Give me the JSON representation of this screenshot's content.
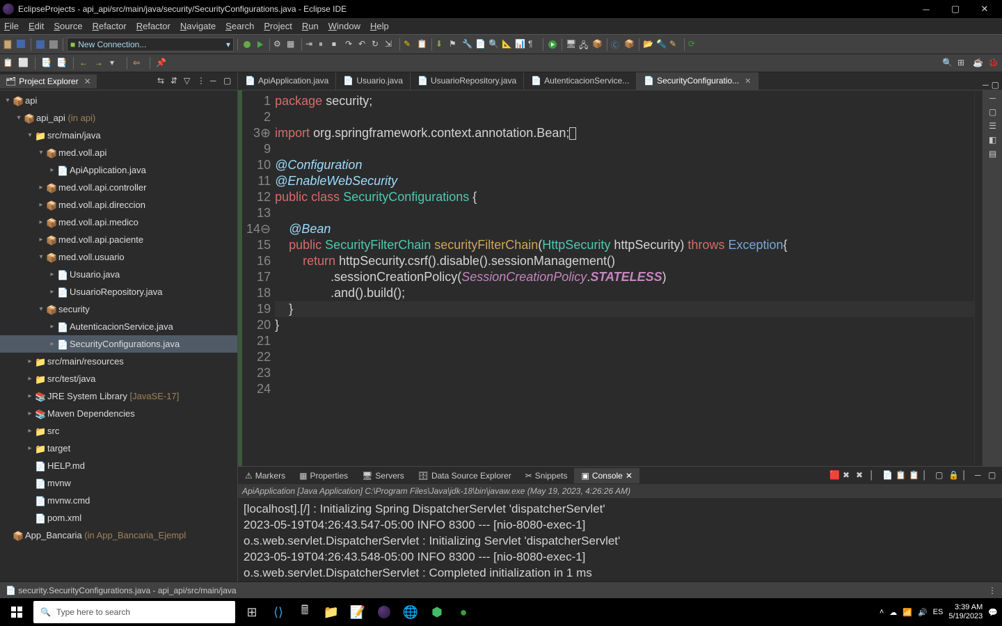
{
  "title_bar": {
    "text": "EclipseProjects - api_api/src/main/java/security/SecurityConfigurations.java - Eclipse IDE"
  },
  "menu": {
    "items": [
      "File",
      "Edit",
      "Source",
      "Refactor",
      "Refactor",
      "Navigate",
      "Search",
      "Project",
      "Run",
      "Window",
      "Help"
    ]
  },
  "toolbar": {
    "combo": "New Connection..."
  },
  "project_explorer": {
    "title": "Project Explorer",
    "tree": [
      {
        "indent": 0,
        "tw": "▾",
        "icon": "proj",
        "label": "api"
      },
      {
        "indent": 1,
        "tw": "▾",
        "icon": "proj",
        "label": "api_api",
        "suffix": " (in api)"
      },
      {
        "indent": 2,
        "tw": "▾",
        "icon": "src",
        "label": "src/main/java"
      },
      {
        "indent": 3,
        "tw": "▾",
        "icon": "pkg",
        "label": "med.voll.api"
      },
      {
        "indent": 4,
        "tw": "▸",
        "icon": "java",
        "label": "ApiApplication.java"
      },
      {
        "indent": 3,
        "tw": "▸",
        "icon": "pkg",
        "label": "med.voll.api.controller"
      },
      {
        "indent": 3,
        "tw": "▸",
        "icon": "pkg",
        "label": "med.voll.api.direccion"
      },
      {
        "indent": 3,
        "tw": "▸",
        "icon": "pkg",
        "label": "med.voll.api.medico"
      },
      {
        "indent": 3,
        "tw": "▸",
        "icon": "pkg",
        "label": "med.voll.api.paciente"
      },
      {
        "indent": 3,
        "tw": "▾",
        "icon": "pkg",
        "label": "med.voll.usuario"
      },
      {
        "indent": 4,
        "tw": "▸",
        "icon": "java",
        "label": "Usuario.java"
      },
      {
        "indent": 4,
        "tw": "▸",
        "icon": "java",
        "label": "UsuarioRepository.java"
      },
      {
        "indent": 3,
        "tw": "▾",
        "icon": "pkg",
        "label": "security"
      },
      {
        "indent": 4,
        "tw": "▸",
        "icon": "java",
        "label": "AutenticacionService.java"
      },
      {
        "indent": 4,
        "tw": "▸",
        "icon": "java",
        "label": "SecurityConfigurations.java",
        "selected": true
      },
      {
        "indent": 2,
        "tw": "▸",
        "icon": "src",
        "label": "src/main/resources"
      },
      {
        "indent": 2,
        "tw": "▸",
        "icon": "src",
        "label": "src/test/java"
      },
      {
        "indent": 2,
        "tw": "▸",
        "icon": "lib",
        "label": "JRE System Library",
        "suffix": " [JavaSE-17]"
      },
      {
        "indent": 2,
        "tw": "▸",
        "icon": "lib",
        "label": "Maven Dependencies"
      },
      {
        "indent": 2,
        "tw": "▸",
        "icon": "folder",
        "label": "src"
      },
      {
        "indent": 2,
        "tw": "▸",
        "icon": "folder",
        "label": "target"
      },
      {
        "indent": 2,
        "tw": "",
        "icon": "file",
        "label": "HELP.md"
      },
      {
        "indent": 2,
        "tw": "",
        "icon": "file",
        "label": "mvnw"
      },
      {
        "indent": 2,
        "tw": "",
        "icon": "file",
        "label": "mvnw.cmd"
      },
      {
        "indent": 2,
        "tw": "",
        "icon": "file",
        "label": "pom.xml"
      },
      {
        "indent": 0,
        "tw": "",
        "icon": "proj",
        "label": "App_Bancaria",
        "suffix": " (in App_Bancaria_Ejempl"
      }
    ]
  },
  "editor_tabs": [
    {
      "label": "ApiApplication.java"
    },
    {
      "label": "Usuario.java"
    },
    {
      "label": "UsuarioRepository.java"
    },
    {
      "label": "AutenticacionService..."
    },
    {
      "label": "SecurityConfiguratio...",
      "active": true
    }
  ],
  "code": {
    "lines": [
      {
        "n": "1",
        "html": "<span class='kw2'>package</span> <span class='punc'>security;</span>"
      },
      {
        "n": "2",
        "html": ""
      },
      {
        "n": "3⊕",
        "html": "<span class='kw2'>import</span> <span class='punc'>org.springframework.context.annotation.Bean;</span><span class='box-cursor'></span>"
      },
      {
        "n": "9",
        "html": ""
      },
      {
        "n": "10",
        "html": "<span class='ann'>@Configuration</span>"
      },
      {
        "n": "11",
        "html": "<span class='ann'>@EnableWebSecurity</span>"
      },
      {
        "n": "12",
        "html": "<span class='kw2'>public</span> <span class='kw2'>class</span> <span class='type'>SecurityConfigurations</span> <span class='punc'>{</span>"
      },
      {
        "n": "13",
        "html": ""
      },
      {
        "n": "14⊖",
        "html": "    <span class='ann'>@Bean</span>"
      },
      {
        "n": "15",
        "html": "    <span class='kw2'>public</span> <span class='type'>SecurityFilterChain</span> <span class='mname'>securityFilterChain</span><span class='punc'>(</span><span class='type'>HttpSecurity</span> <span class='punc'>httpSecurity)</span> <span class='kw2'>throws</span> <span class='type2'>Exception</span><span class='punc'>{</span>"
      },
      {
        "n": "16",
        "html": "        <span class='kw2'>return</span> <span class='punc'>httpSecurity.csrf().disable().sessionManagement()</span>"
      },
      {
        "n": "17",
        "html": "                <span class='punc'>.sessionCreationPolicy(</span><span class='enum'>SessionCreationPolicy</span><span class='punc'>.</span><span class='enum' style='font-weight:bold'>STATELESS</span><span class='punc'>)</span>"
      },
      {
        "n": "18",
        "html": "                <span class='punc'>.and().build();</span>"
      },
      {
        "n": "19",
        "html": "    <span class='punc'>}</span>",
        "hl": true
      },
      {
        "n": "20",
        "html": "<span class='punc'>}</span>"
      },
      {
        "n": "21",
        "html": ""
      },
      {
        "n": "22",
        "html": ""
      },
      {
        "n": "23",
        "html": ""
      },
      {
        "n": "24",
        "html": ""
      }
    ]
  },
  "bottom_tabs": [
    "Markers",
    "Properties",
    "Servers",
    "Data Source Explorer",
    "Snippets",
    "Console"
  ],
  "console": {
    "header": "ApiApplication [Java Application] C:\\Program Files\\Java\\jdk-18\\bin\\javaw.exe  (May 19, 2023, 4:26:26 AM)",
    "lines": [
      "[localhost].[/]            : Initializing Spring DispatcherServlet 'dispatcherServlet'",
      "2023-05-19T04:26:43.547-05:00  INFO 8300 --- [nio-8080-exec-1]",
      "o.s.web.servlet.DispatcherServlet        : Initializing Servlet 'dispatcherServlet'",
      "2023-05-19T04:26:43.548-05:00  INFO 8300 --- [nio-8080-exec-1]",
      "o.s.web.servlet.DispatcherServlet        : Completed initialization in 1 ms"
    ]
  },
  "status_bar": {
    "text": "security.SecurityConfigurations.java - api_api/src/main/java"
  },
  "taskbar": {
    "search_placeholder": "Type here to search",
    "lang": "ES",
    "time": "3:39 AM",
    "date": "5/19/2023"
  }
}
